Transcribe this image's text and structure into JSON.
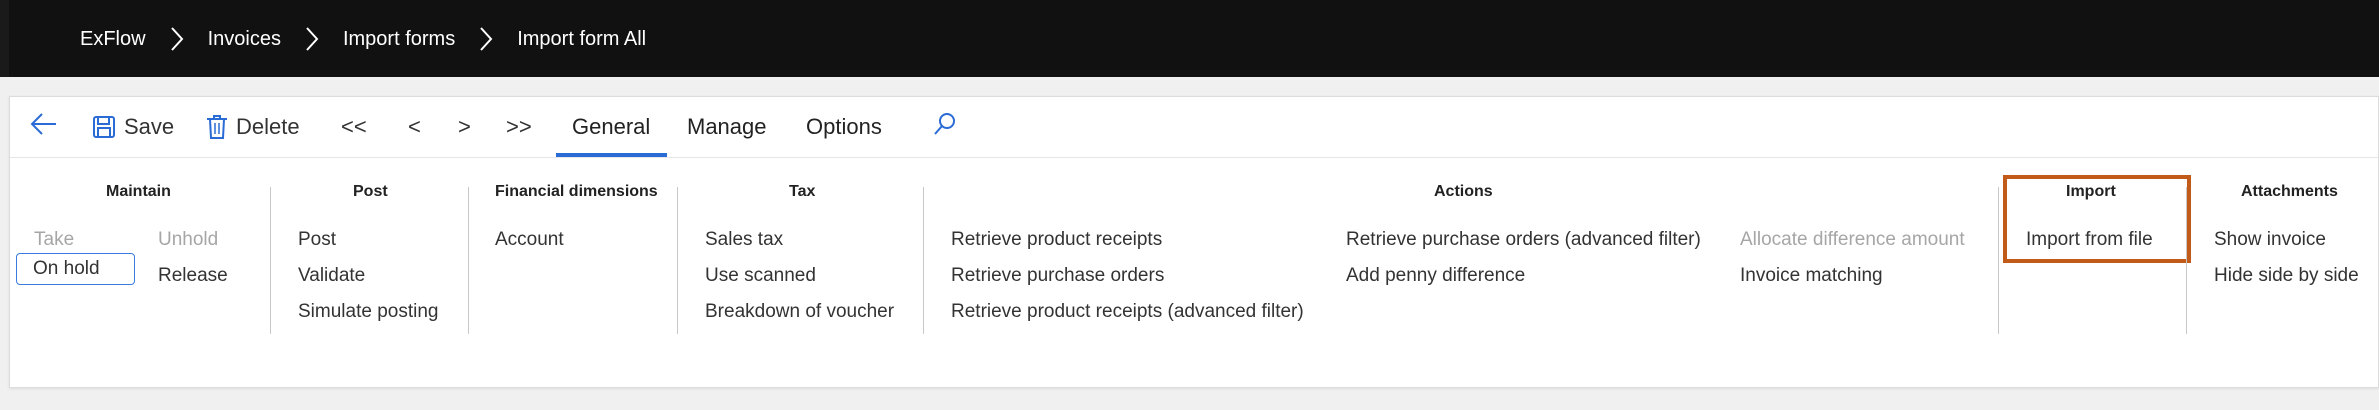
{
  "breadcrumb": [
    "ExFlow",
    "Invoices",
    "Import forms",
    "Import form All"
  ],
  "toolbar": {
    "save_label": "Save",
    "delete_label": "Delete",
    "first_label": "<<",
    "prev_label": "<",
    "next_label": ">",
    "last_label": ">>"
  },
  "tabs": [
    "General",
    "Manage",
    "Options"
  ],
  "active_tab": "General",
  "groups": {
    "maintain": {
      "title": "Maintain",
      "take": "Take",
      "unhold": "Unhold",
      "on_hold": "On hold",
      "release": "Release"
    },
    "post": {
      "title": "Post",
      "items": [
        "Post",
        "Validate",
        "Simulate posting"
      ]
    },
    "financial": {
      "title": "Financial dimensions",
      "items": [
        "Account"
      ]
    },
    "tax": {
      "title": "Tax",
      "items": [
        "Sales tax",
        "Use scanned",
        "Breakdown of voucher"
      ]
    },
    "actions": {
      "title": "Actions",
      "col1": [
        "Retrieve product receipts",
        "Retrieve purchase orders",
        "Retrieve product receipts (advanced filter)"
      ],
      "col2": [
        "Retrieve purchase orders (advanced filter)",
        "Add penny difference"
      ],
      "col3": [
        "Allocate difference amount",
        "Invoice matching"
      ]
    },
    "import": {
      "title": "Import",
      "items": [
        "Import from file"
      ]
    },
    "attachments": {
      "title": "Attachments",
      "items": [
        "Show invoice",
        "Hide side by side"
      ]
    }
  },
  "colors": {
    "nav_bg": "#111111",
    "accent": "#2b6bd6",
    "highlight": "#c25a1a",
    "disabled": "#a6a6a6"
  },
  "icons": [
    "back-arrow-icon",
    "save-icon",
    "delete-icon",
    "search-icon",
    "chevron-right-icon"
  ]
}
